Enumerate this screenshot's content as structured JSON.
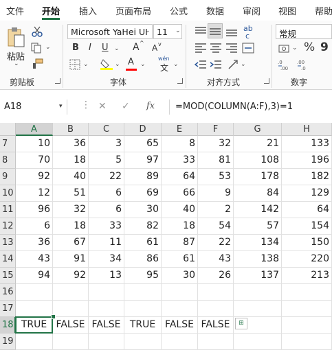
{
  "menu": {
    "tabs": [
      "文件",
      "开始",
      "插入",
      "页面布局",
      "公式",
      "数据",
      "审阅",
      "视图",
      "帮助"
    ],
    "active": "开始"
  },
  "ribbon": {
    "clipboard": {
      "paste_label": "粘贴",
      "group_label": "剪贴板"
    },
    "font": {
      "font_name": "Microsoft YaHei UI",
      "font_size": "11",
      "bold": "B",
      "italic": "I",
      "underline": "U",
      "grow": "A",
      "shrink": "A",
      "wen": "wén",
      "wen_char": "文",
      "group_label": "字体",
      "highlight_color": "#ffff00",
      "font_color": "#ff0000"
    },
    "alignment": {
      "group_label": "对齐方式",
      "wrap": "ab",
      "wrap2": "c"
    },
    "number": {
      "format": "常规",
      "percent": "%",
      "comma": "9",
      "group_label": "数字"
    }
  },
  "formula_bar": {
    "name_box": "A18",
    "cancel": "✕",
    "enter": "✓",
    "fx": "fx",
    "formula": "=MOD(COLUMN(A:F),3)=1"
  },
  "grid": {
    "columns": [
      "A",
      "B",
      "C",
      "D",
      "E",
      "F",
      "G",
      "H"
    ],
    "selected_column": "A",
    "selected_row": "18",
    "rows": [
      {
        "label": "7",
        "cells": [
          "10",
          "36",
          "3",
          "65",
          "8",
          "32",
          "21",
          "133"
        ]
      },
      {
        "label": "8",
        "cells": [
          "70",
          "18",
          "5",
          "97",
          "33",
          "81",
          "108",
          "196"
        ]
      },
      {
        "label": "9",
        "cells": [
          "92",
          "40",
          "22",
          "89",
          "64",
          "53",
          "178",
          "182"
        ]
      },
      {
        "label": "10",
        "cells": [
          "12",
          "51",
          "6",
          "69",
          "66",
          "9",
          "84",
          "129"
        ]
      },
      {
        "label": "11",
        "cells": [
          "96",
          "32",
          "6",
          "30",
          "40",
          "2",
          "142",
          "64"
        ]
      },
      {
        "label": "12",
        "cells": [
          "6",
          "18",
          "33",
          "82",
          "18",
          "54",
          "57",
          "154"
        ]
      },
      {
        "label": "13",
        "cells": [
          "36",
          "67",
          "11",
          "61",
          "87",
          "22",
          "134",
          "150"
        ]
      },
      {
        "label": "14",
        "cells": [
          "43",
          "91",
          "34",
          "86",
          "61",
          "43",
          "138",
          "220"
        ]
      },
      {
        "label": "15",
        "cells": [
          "94",
          "92",
          "13",
          "95",
          "30",
          "26",
          "137",
          "213"
        ]
      },
      {
        "label": "16",
        "cells": [
          "",
          "",
          "",
          "",
          "",
          "",
          "",
          ""
        ]
      },
      {
        "label": "17",
        "cells": [
          "",
          "",
          "",
          "",
          "",
          "",
          "",
          ""
        ]
      },
      {
        "label": "18",
        "cells": [
          "TRUE",
          "FALSE",
          "FALSE",
          "TRUE",
          "FALSE",
          "FALSE",
          "",
          ""
        ]
      },
      {
        "label": "19",
        "cells": [
          "",
          "",
          "",
          "",
          "",
          "",
          "",
          ""
        ]
      }
    ]
  },
  "colors": {
    "accent": "#217346"
  }
}
